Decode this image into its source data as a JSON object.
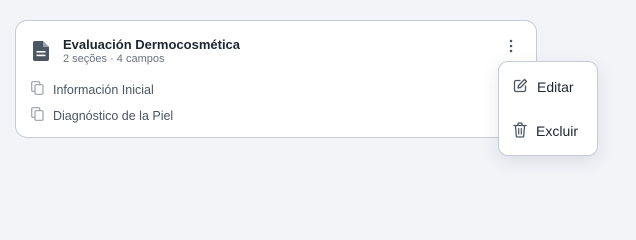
{
  "card": {
    "title": "Evaluación Dermocosmética",
    "subtitle": "2 seções · 4 campos",
    "sections": [
      {
        "label": "Información Inicial"
      },
      {
        "label": "Diagnóstico de la Piel"
      }
    ],
    "icons": {
      "document": "file-text-icon",
      "more": "more-vertical-icon",
      "section": "copy-icon"
    }
  },
  "menu": {
    "edit_label": "Editar",
    "delete_label": "Excluir",
    "icons": {
      "edit": "pencil-square-icon",
      "delete": "trash-icon"
    }
  },
  "colors": {
    "background": "#f2f4f8",
    "card_border": "#c6ccd6",
    "text_primary": "#1e2533",
    "text_secondary": "#6b7280"
  }
}
